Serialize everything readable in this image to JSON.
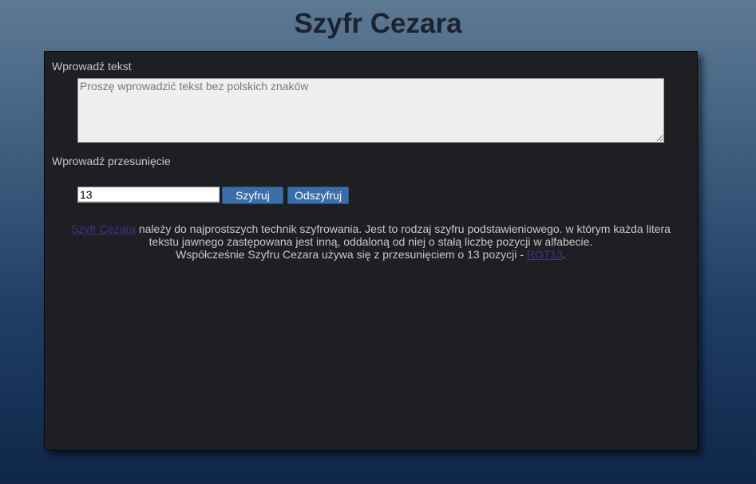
{
  "header": {
    "title": "Szyfr Cezara"
  },
  "form": {
    "text_label": "Wprowadź tekst",
    "text_placeholder": "Proszę wprowadzić tekst bez polskich znaków",
    "text_value": "",
    "shift_label": "Wprowadź przesunięcie",
    "shift_value": "13",
    "encrypt_label": "Szyfruj",
    "decrypt_label": "Odszyfruj"
  },
  "description": {
    "link_caesar": "Szyfr Cezara",
    "line1_rest": " należy do najprostszych technik szyfrowania. Jest to rodzaj szyfru podstawieniowego. w którym każda litera",
    "line2": "tekstu jawnego zastępowana jest inną, oddaloną od niej o stałą liczbę pozycji w alfabecie.",
    "line3_start": "Współcześnie Szyfru Cezara używa się z przesunięciem o 13 pozycji - ",
    "link_rot13": "ROT13",
    "line3_end": "."
  },
  "colors": {
    "panel_bg": "#1e1f22",
    "button_bg": "#3a6ea8",
    "link": "#4a2c8a"
  }
}
